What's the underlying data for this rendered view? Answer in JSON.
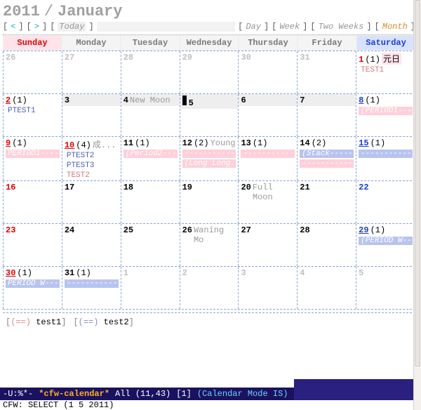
{
  "title": {
    "year": "2011",
    "sep": "/",
    "month": "January"
  },
  "nav": {
    "prev_group": "<",
    "next_group": ">",
    "today": "Today",
    "views": {
      "day": "Day",
      "week": "Week",
      "two_weeks": "Two Weeks",
      "month": "Month"
    }
  },
  "day_headers": [
    "Sunday",
    "Monday",
    "Tuesday",
    "Wednesday",
    "Thursday",
    "Friday",
    "Saturday"
  ],
  "weeks": [
    [
      {
        "n": "26",
        "dim": true
      },
      {
        "n": "27",
        "dim": true
      },
      {
        "n": "28",
        "dim": true
      },
      {
        "n": "29",
        "dim": true
      },
      {
        "n": "30",
        "dim": true
      },
      {
        "n": "31",
        "dim": true
      },
      {
        "n": "1",
        "red": true,
        "count": "(1)",
        "hol": "元日",
        "tags": [
          {
            "t": "TEST1",
            "cls": "plain"
          }
        ]
      }
    ],
    [
      {
        "n": "2",
        "red": true,
        "under": true,
        "count": "(1)",
        "tags": [
          {
            "t": "PTEST1",
            "cls": "plain-blue"
          }
        ]
      },
      {
        "n": "3",
        "shade": true
      },
      {
        "n": "4",
        "extra": "New Moon",
        "shade": true
      },
      {
        "n": "5",
        "shade": true,
        "selected": true
      },
      {
        "n": "6",
        "shade": true
      },
      {
        "n": "7",
        "shade": true
      },
      {
        "n": "8",
        "blue": true,
        "under": true,
        "count": "(1)",
        "tags": [
          {
            "t": "(PERIOD1-----",
            "cls": "pinkbar"
          }
        ]
      }
    ],
    [
      {
        "n": "9",
        "red": true,
        "under": true,
        "count": "(1)",
        "tags": [
          {
            "t": "PERIOD1-----)",
            "cls": "pinkbar"
          }
        ]
      },
      {
        "n": "10",
        "red": true,
        "under": true,
        "count": "(4)",
        "extra": "成...",
        "tags": [
          {
            "t": "PTEST2",
            "cls": "plain-blue"
          },
          {
            "t": "PTEST3",
            "cls": "plain-blue"
          },
          {
            "t": "TEST2",
            "cls": "plain"
          }
        ]
      },
      {
        "n": "11",
        "count": "(1)",
        "tags": [
          {
            "t": "(Period2----",
            "cls": "pinkbar"
          }
        ]
      },
      {
        "n": "12",
        "count": "(2)",
        "extra": "Young",
        "tags": [
          {
            "t": "-----------",
            "cls": "pinkbar"
          },
          {
            "t": "(Long Long...",
            "cls": "pinkbar"
          }
        ]
      },
      {
        "n": "13",
        "count": "(1)",
        "tags": [
          {
            "t": "-----------",
            "cls": "pinkbar"
          }
        ]
      },
      {
        "n": "14",
        "count": "(2)",
        "tags": [
          {
            "t": "(Stack-------",
            "cls": "bluebar"
          },
          {
            "t": "-----------)",
            "cls": "pinkbar"
          }
        ]
      },
      {
        "n": "15",
        "blue": true,
        "under": true,
        "count": "(1)",
        "tags": [
          {
            "t": "-----------)",
            "cls": "bluebar"
          }
        ]
      }
    ],
    [
      {
        "n": "16",
        "red": true
      },
      {
        "n": "17"
      },
      {
        "n": "18"
      },
      {
        "n": "19"
      },
      {
        "n": "20",
        "extra": "Full Moon"
      },
      {
        "n": "21"
      },
      {
        "n": "22",
        "blue": true
      }
    ],
    [
      {
        "n": "23",
        "red": true
      },
      {
        "n": "24"
      },
      {
        "n": "25"
      },
      {
        "n": "26",
        "extra": "Waning Mo"
      },
      {
        "n": "27"
      },
      {
        "n": "28"
      },
      {
        "n": "29",
        "blue": true,
        "under": true,
        "count": "(1)",
        "tags": [
          {
            "t": "(PERIOD W----",
            "cls": "bluebar"
          }
        ]
      }
    ],
    [
      {
        "n": "30",
        "red": true,
        "under": true,
        "count": "(1)",
        "tags": [
          {
            "t": "PERIOD W----",
            "cls": "bluebar"
          }
        ]
      },
      {
        "n": "31",
        "count": "(1)",
        "tags": [
          {
            "t": "-----------)",
            "cls": "bluebar"
          }
        ]
      },
      {
        "n": "1",
        "dim": true
      },
      {
        "n": "2",
        "dim": true
      },
      {
        "n": "3",
        "dim": true
      },
      {
        "n": "4",
        "dim": true
      },
      {
        "n": "5",
        "dim": true
      }
    ]
  ],
  "legend": {
    "item1": "test1",
    "item2": "test2"
  },
  "modeline": {
    "left": "-U:%*-",
    "buffer": "*cfw-calendar*",
    "pos": "All (11,43)",
    "num": "[1]",
    "mode": "(Calendar Mode IS)"
  },
  "minibuffer": "CFW: SELECT (1 5 2011)"
}
